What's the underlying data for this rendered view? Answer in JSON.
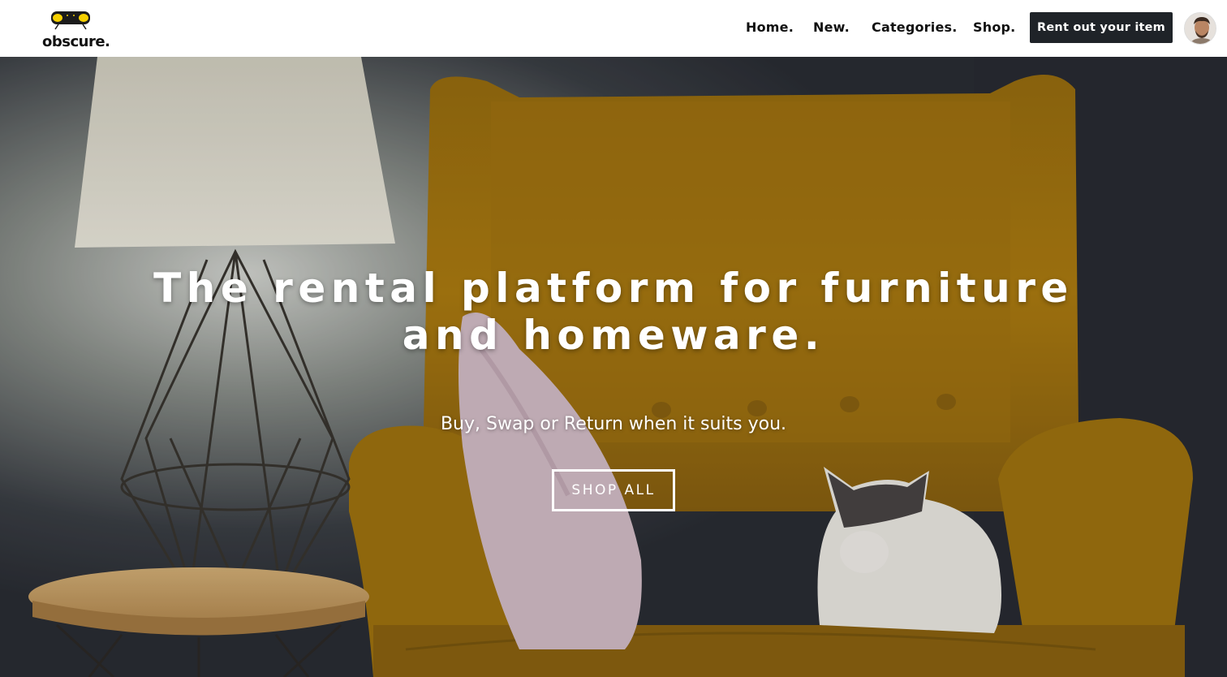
{
  "navbar": {
    "logo_text": "obscure.",
    "logo_icon": "sofa-icon",
    "links": [
      {
        "label": "Home."
      },
      {
        "label": "New."
      },
      {
        "label": "Categories."
      },
      {
        "label": "Shop."
      }
    ],
    "cta_label": "Rent out your item",
    "avatar_icon": "user-avatar"
  },
  "hero": {
    "title": "The rental platform for furniture and homeware.",
    "subtitle": "Buy, Swap or Return when it suits you.",
    "button_label": "SHOP ALL",
    "image_subject": "yellow armchair with lamp, pillow and cat"
  },
  "colors": {
    "accent_yellow": "#f5d000",
    "cta_background": "#1f2328",
    "hero_text": "#ffffff"
  }
}
